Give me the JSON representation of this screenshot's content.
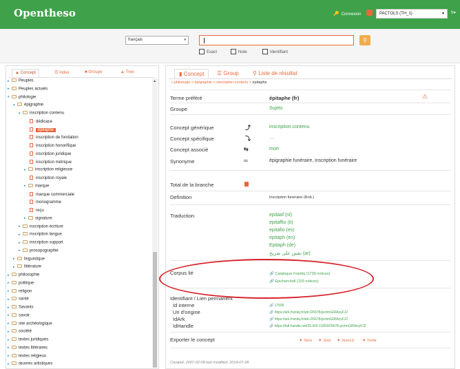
{
  "app": {
    "logo": "Opentheso",
    "connexion": "Connexion",
    "thesaurus": "PACTOLS (TH_1)",
    "lang": "fr"
  },
  "search": {
    "lang_value": "français",
    "options": [
      "Exact",
      "Note",
      "Identifiant"
    ]
  },
  "left": {
    "tabs": [
      "Concept",
      "Index",
      "Groupe",
      "Tree"
    ],
    "tree": [
      "Peuples",
      "Peuples actuels",
      "philologie",
      "épigraphie",
      "inscription contenu",
      "dédicace",
      "épitaphe",
      "inscription de fondation",
      "inscription honorifique",
      "inscription juridique",
      "inscription métrique",
      "inscription religieuse",
      "inscription royale",
      "marque",
      "marque commerciale",
      "monogramme",
      "reçu",
      "signature",
      "inscription écriture",
      "inscription langue",
      "inscription support",
      "prosopographie",
      "linguistique",
      "littérature",
      "philosophie",
      "politique",
      "religion",
      "santé",
      "Savants",
      "savoir",
      "site archéologique",
      "société",
      "textes juridiques",
      "textes littéraires",
      "textes religieux",
      "œuvres artistiques"
    ]
  },
  "right": {
    "tabs": [
      "Concept",
      "Group",
      "Liste de résultat"
    ],
    "breadcrumb": [
      "philologie",
      "épigraphie",
      "inscription contenu",
      "épitaphe"
    ],
    "fields": {
      "terme_prefere_label": "Terme préféré",
      "terme_prefere_value": "épitaphe (fr)",
      "groupe_label": "Groupe",
      "groupe_value": "Sujets",
      "generique_label": "Concept générique",
      "generique_value": "inscription contenu",
      "specifique_label": "Concept spécifique",
      "specifique_value": "....",
      "associe_label": "Concept associé",
      "associe_value": "mort",
      "synonyme_label": "Synonyme",
      "synonyme_value": "épigraphie funéraire, inscription funéraire",
      "total_label": "Total de la branche",
      "definition_label": "Definition",
      "definition_value": "Inscription funéraire (Rob.)",
      "traduction_label": "Traduction",
      "traductions": [
        "epitaaf (nl)",
        "epitaffio (it)",
        "epitafio (es)",
        "epitaph (en)",
        "Epitaph (de)",
        "نقش على ضريح (ar)"
      ],
      "corpus_label": "Corpus lié",
      "corpus": [
        "Catalogue Frantiq (1739 notices)",
        "Epicherchell (103 notices)"
      ],
      "identifiant_label": "Identifiant / Lien permanent",
      "id_interne_label": "Id interne",
      "id_interne_value": "17695",
      "uri_label": "Uri d'origine",
      "uri_value": "https://ark.frantiq.fr/ark:/26678/pcrtmGIRAoyFJ2",
      "idark_label": "IdArk",
      "idark_value": "https://ark.frantiq.fr/ark:/26678/pcrtmGIRAoyFJ2",
      "idhandle_label": "IdHandle",
      "idhandle_value": "https://hdl.handle.net/20.500.11859/26678.pcrtmGIRAoyFJ2",
      "export_label": "Exporter le concept",
      "export": [
        "Skos",
        "Json",
        "JsonLd",
        "Turtle"
      ],
      "created": "Created: 2007-02-08 last modified: 2014-07-28"
    }
  },
  "colors": {
    "brand": "#3fa14a",
    "accent": "#e9683b",
    "annotation": "#d8232a"
  }
}
